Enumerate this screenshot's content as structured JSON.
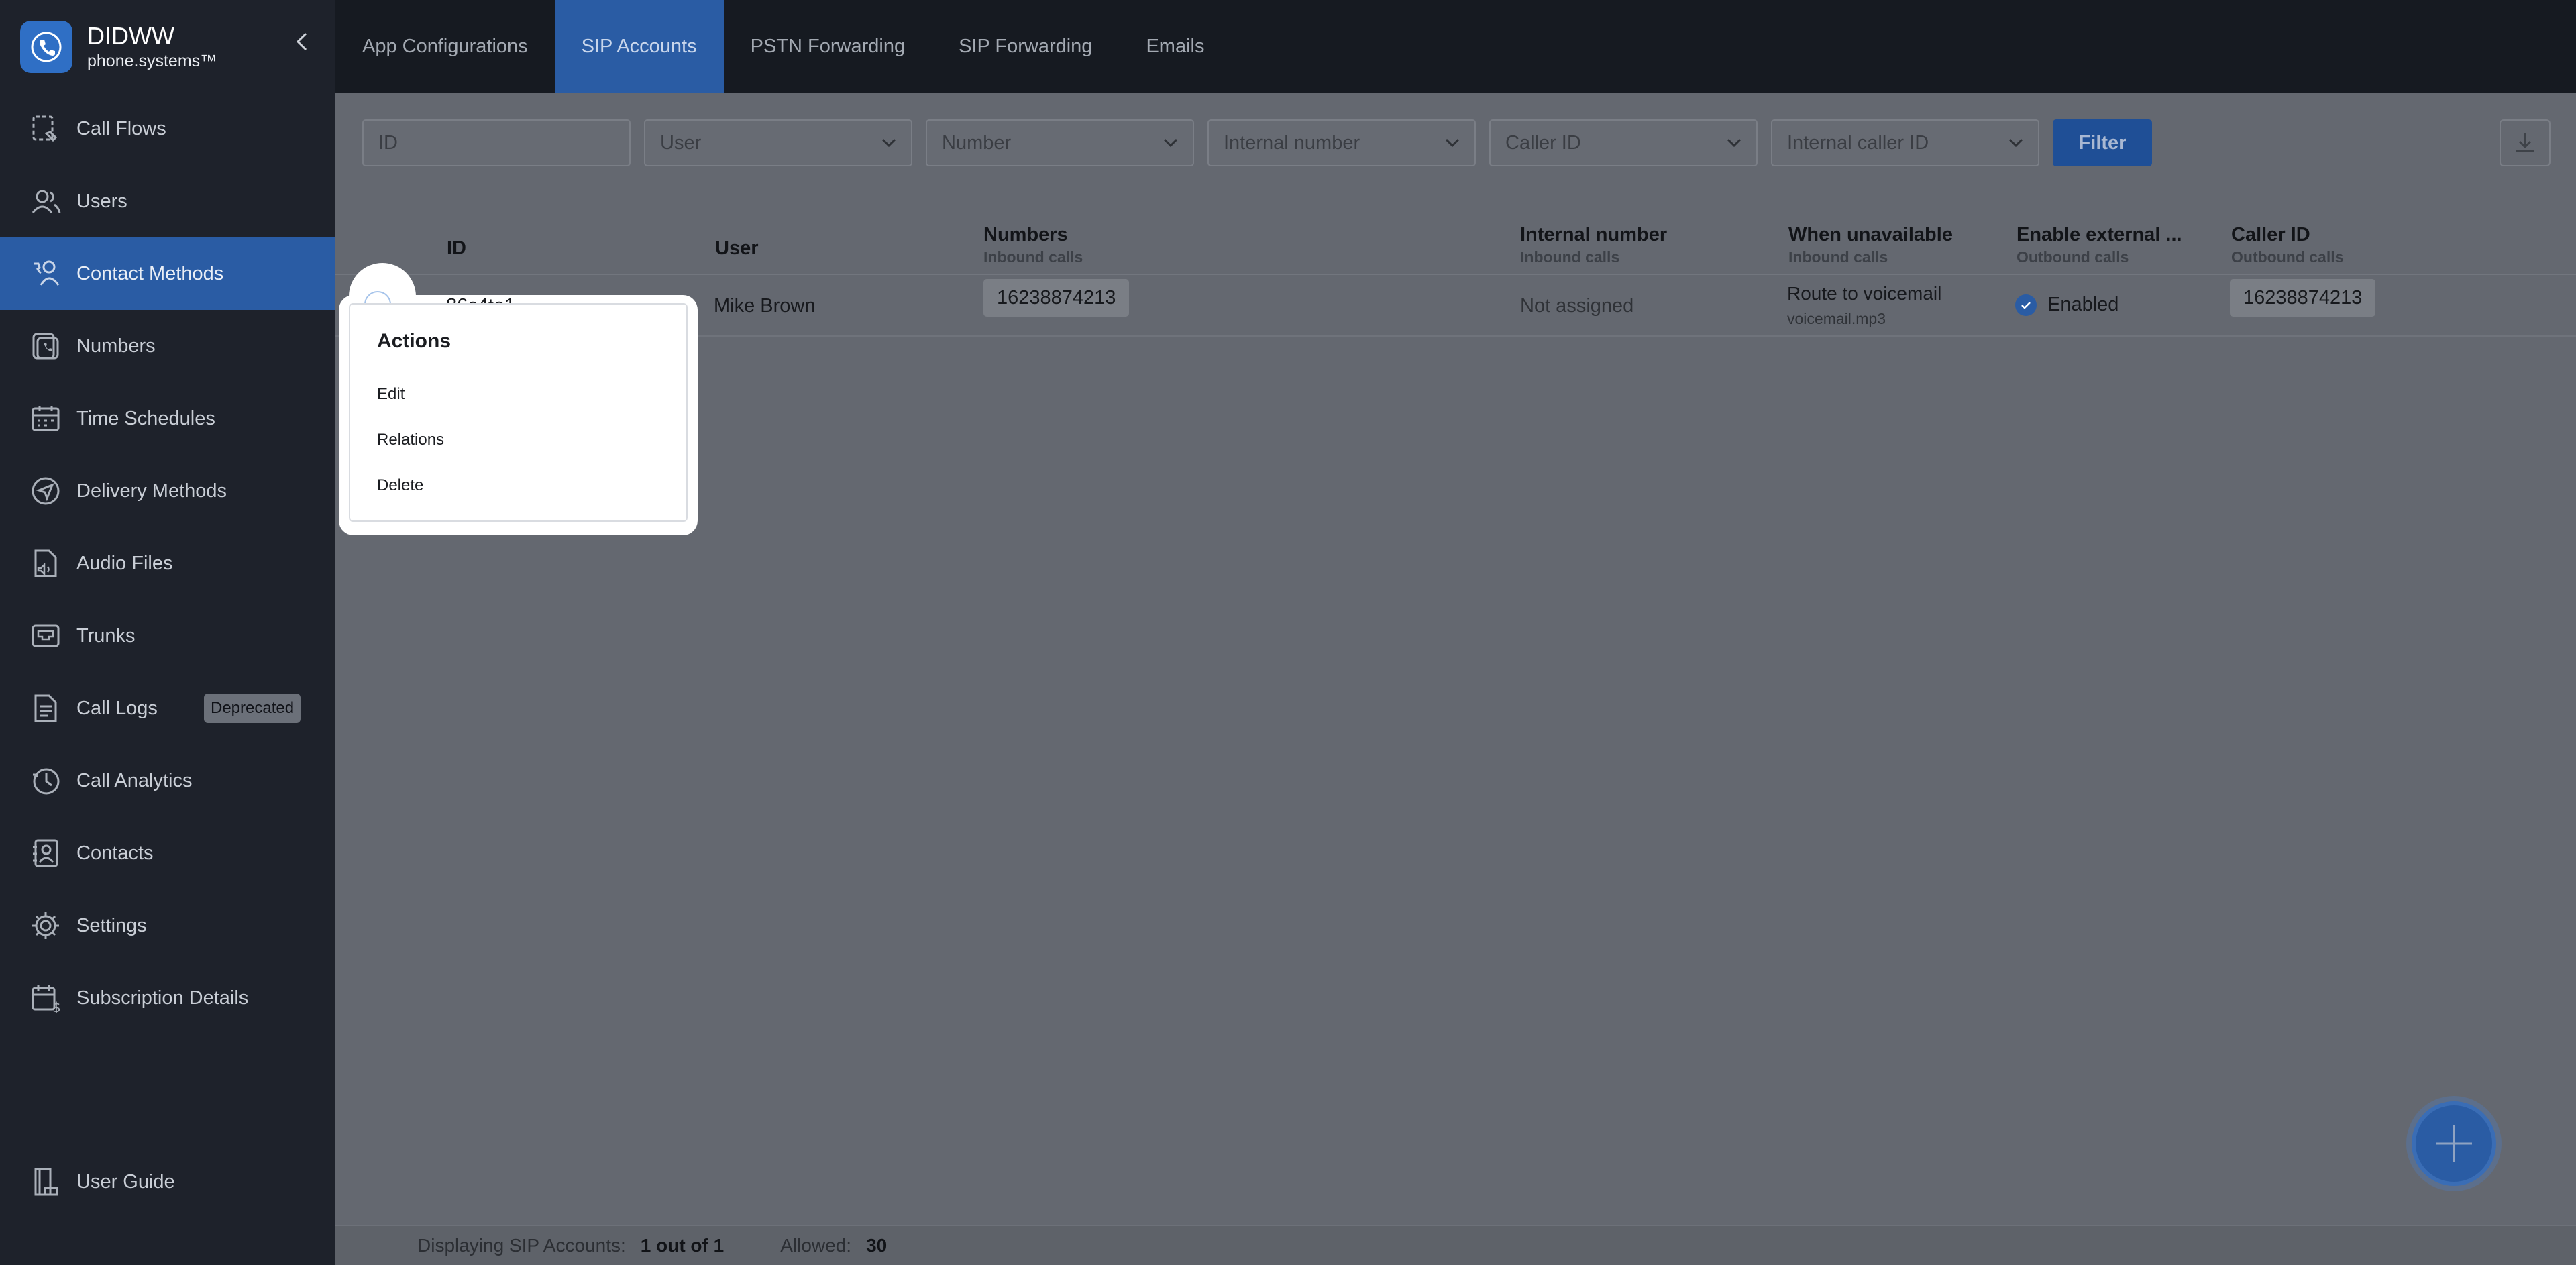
{
  "brand": {
    "name": "DIDWW",
    "subtitle": "phone.systems™"
  },
  "sidebar": {
    "items": [
      {
        "label": "Call Flows",
        "icon": "call-flows-icon"
      },
      {
        "label": "Users",
        "icon": "users-icon"
      },
      {
        "label": "Contact Methods",
        "icon": "contact-methods-icon",
        "active": true
      },
      {
        "label": "Numbers",
        "icon": "numbers-icon"
      },
      {
        "label": "Time Schedules",
        "icon": "calendar-icon"
      },
      {
        "label": "Delivery Methods",
        "icon": "send-icon"
      },
      {
        "label": "Audio Files",
        "icon": "audio-file-icon"
      },
      {
        "label": "Trunks",
        "icon": "trunk-icon"
      },
      {
        "label": "Call Logs",
        "icon": "document-icon",
        "badge": "Deprecated"
      },
      {
        "label": "Call Analytics",
        "icon": "analytics-icon"
      },
      {
        "label": "Contacts",
        "icon": "contacts-icon"
      },
      {
        "label": "Settings",
        "icon": "gear-icon"
      },
      {
        "label": "Subscription Details",
        "icon": "subscription-icon"
      }
    ],
    "guide": {
      "label": "User Guide",
      "icon": "user-guide-icon"
    }
  },
  "tabs": [
    {
      "label": "App Configurations"
    },
    {
      "label": "SIP Accounts",
      "active": true
    },
    {
      "label": "PSTN Forwarding"
    },
    {
      "label": "SIP Forwarding"
    },
    {
      "label": "Emails"
    }
  ],
  "filters": {
    "id_placeholder": "ID",
    "user": "User",
    "number": "Number",
    "internal_number": "Internal number",
    "caller_id": "Caller ID",
    "internal_caller_id": "Internal caller ID",
    "button": "Filter"
  },
  "table": {
    "columns": [
      {
        "label": "ID",
        "sub": ""
      },
      {
        "label": "User",
        "sub": ""
      },
      {
        "label": "Numbers",
        "sub": "Inbound calls"
      },
      {
        "label": "Internal number",
        "sub": "Inbound calls"
      },
      {
        "label": "When unavailable",
        "sub": "Inbound calls"
      },
      {
        "label": "Enable external ...",
        "sub": "Outbound calls"
      },
      {
        "label": "Caller ID",
        "sub": "Outbound calls"
      }
    ],
    "row": {
      "id": "86c4te1",
      "user": "Mike Brown",
      "number": "16238874213",
      "internal_number": "Not assigned",
      "unavailable": "Route to voicemail",
      "unavailable_file": "voicemail.mp3",
      "external": "Enabled",
      "caller_id": "16238874213"
    }
  },
  "popup": {
    "title": "Actions",
    "items": [
      "Edit",
      "Relations",
      "Delete"
    ]
  },
  "footer": {
    "displaying_label": "Displaying SIP Accounts:",
    "displaying_value": "1 out of 1",
    "allowed_label": "Allowed:",
    "allowed_value": "30"
  },
  "colors": {
    "accent": "#2a5ca4",
    "sidebar": "#1e222b",
    "overlay": "#646870"
  }
}
